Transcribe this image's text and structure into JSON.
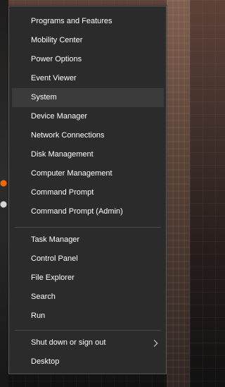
{
  "menu": {
    "items": [
      "Programs and Features",
      "Mobility Center",
      "Power Options",
      "Event Viewer",
      "System",
      "Device Manager",
      "Network Connections",
      "Disk Management",
      "Computer Management",
      "Command Prompt",
      "Command Prompt (Admin)",
      "Task Manager",
      "Control Panel",
      "File Explorer",
      "Search",
      "Run",
      "Shut down or sign out",
      "Desktop"
    ]
  }
}
